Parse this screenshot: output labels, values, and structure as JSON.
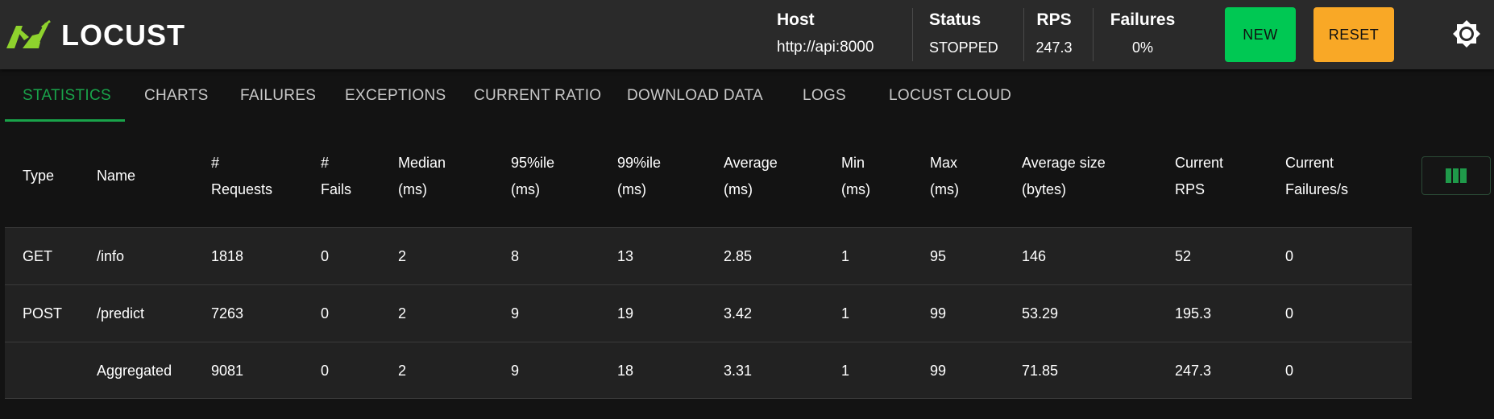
{
  "app": {
    "name": "LOCUST"
  },
  "header": {
    "host": {
      "label": "Host",
      "value": "http://api:8000"
    },
    "status": {
      "label": "Status",
      "value": "STOPPED"
    },
    "rps": {
      "label": "RPS",
      "value": "247.3"
    },
    "failures": {
      "label": "Failures",
      "value": "0%"
    },
    "new_label": "NEW",
    "reset_label": "RESET"
  },
  "colors": {
    "brand_green": "#8ed22d",
    "new_button": "#00c853",
    "reset_button": "#f9a826",
    "active_tab": "#19a34a"
  },
  "tabs": [
    {
      "label": "STATISTICS",
      "active": true
    },
    {
      "label": "CHARTS"
    },
    {
      "label": "FAILURES"
    },
    {
      "label": "EXCEPTIONS"
    },
    {
      "label": "CURRENT RATIO"
    },
    {
      "label": "DOWNLOAD DATA"
    },
    {
      "label": "LOGS"
    },
    {
      "label": "LOCUST CLOUD"
    }
  ],
  "table": {
    "headers": [
      [
        "Type"
      ],
      [
        "Name"
      ],
      [
        "#",
        "Requests"
      ],
      [
        "#",
        "Fails"
      ],
      [
        "Median",
        "(ms)"
      ],
      [
        "95%ile",
        "(ms)"
      ],
      [
        "99%ile",
        "(ms)"
      ],
      [
        "Average",
        "(ms)"
      ],
      [
        "Min",
        "(ms)"
      ],
      [
        "Max",
        "(ms)"
      ],
      [
        "Average size",
        "(bytes)"
      ],
      [
        "Current",
        "RPS"
      ],
      [
        "Current",
        "Failures/s"
      ]
    ],
    "rows": [
      [
        "GET",
        "/info",
        "1818",
        "0",
        "2",
        "8",
        "13",
        "2.85",
        "1",
        "95",
        "146",
        "52",
        "0"
      ],
      [
        "POST",
        "/predict",
        "7263",
        "0",
        "2",
        "9",
        "19",
        "3.42",
        "1",
        "99",
        "53.29",
        "195.3",
        "0"
      ],
      [
        "",
        "Aggregated",
        "9081",
        "0",
        "2",
        "9",
        "18",
        "3.31",
        "1",
        "99",
        "71.85",
        "247.3",
        "0"
      ]
    ]
  },
  "icons": {
    "logo": "locust-logo-icon",
    "theme": "sun-icon",
    "columns": "view-column-icon"
  }
}
